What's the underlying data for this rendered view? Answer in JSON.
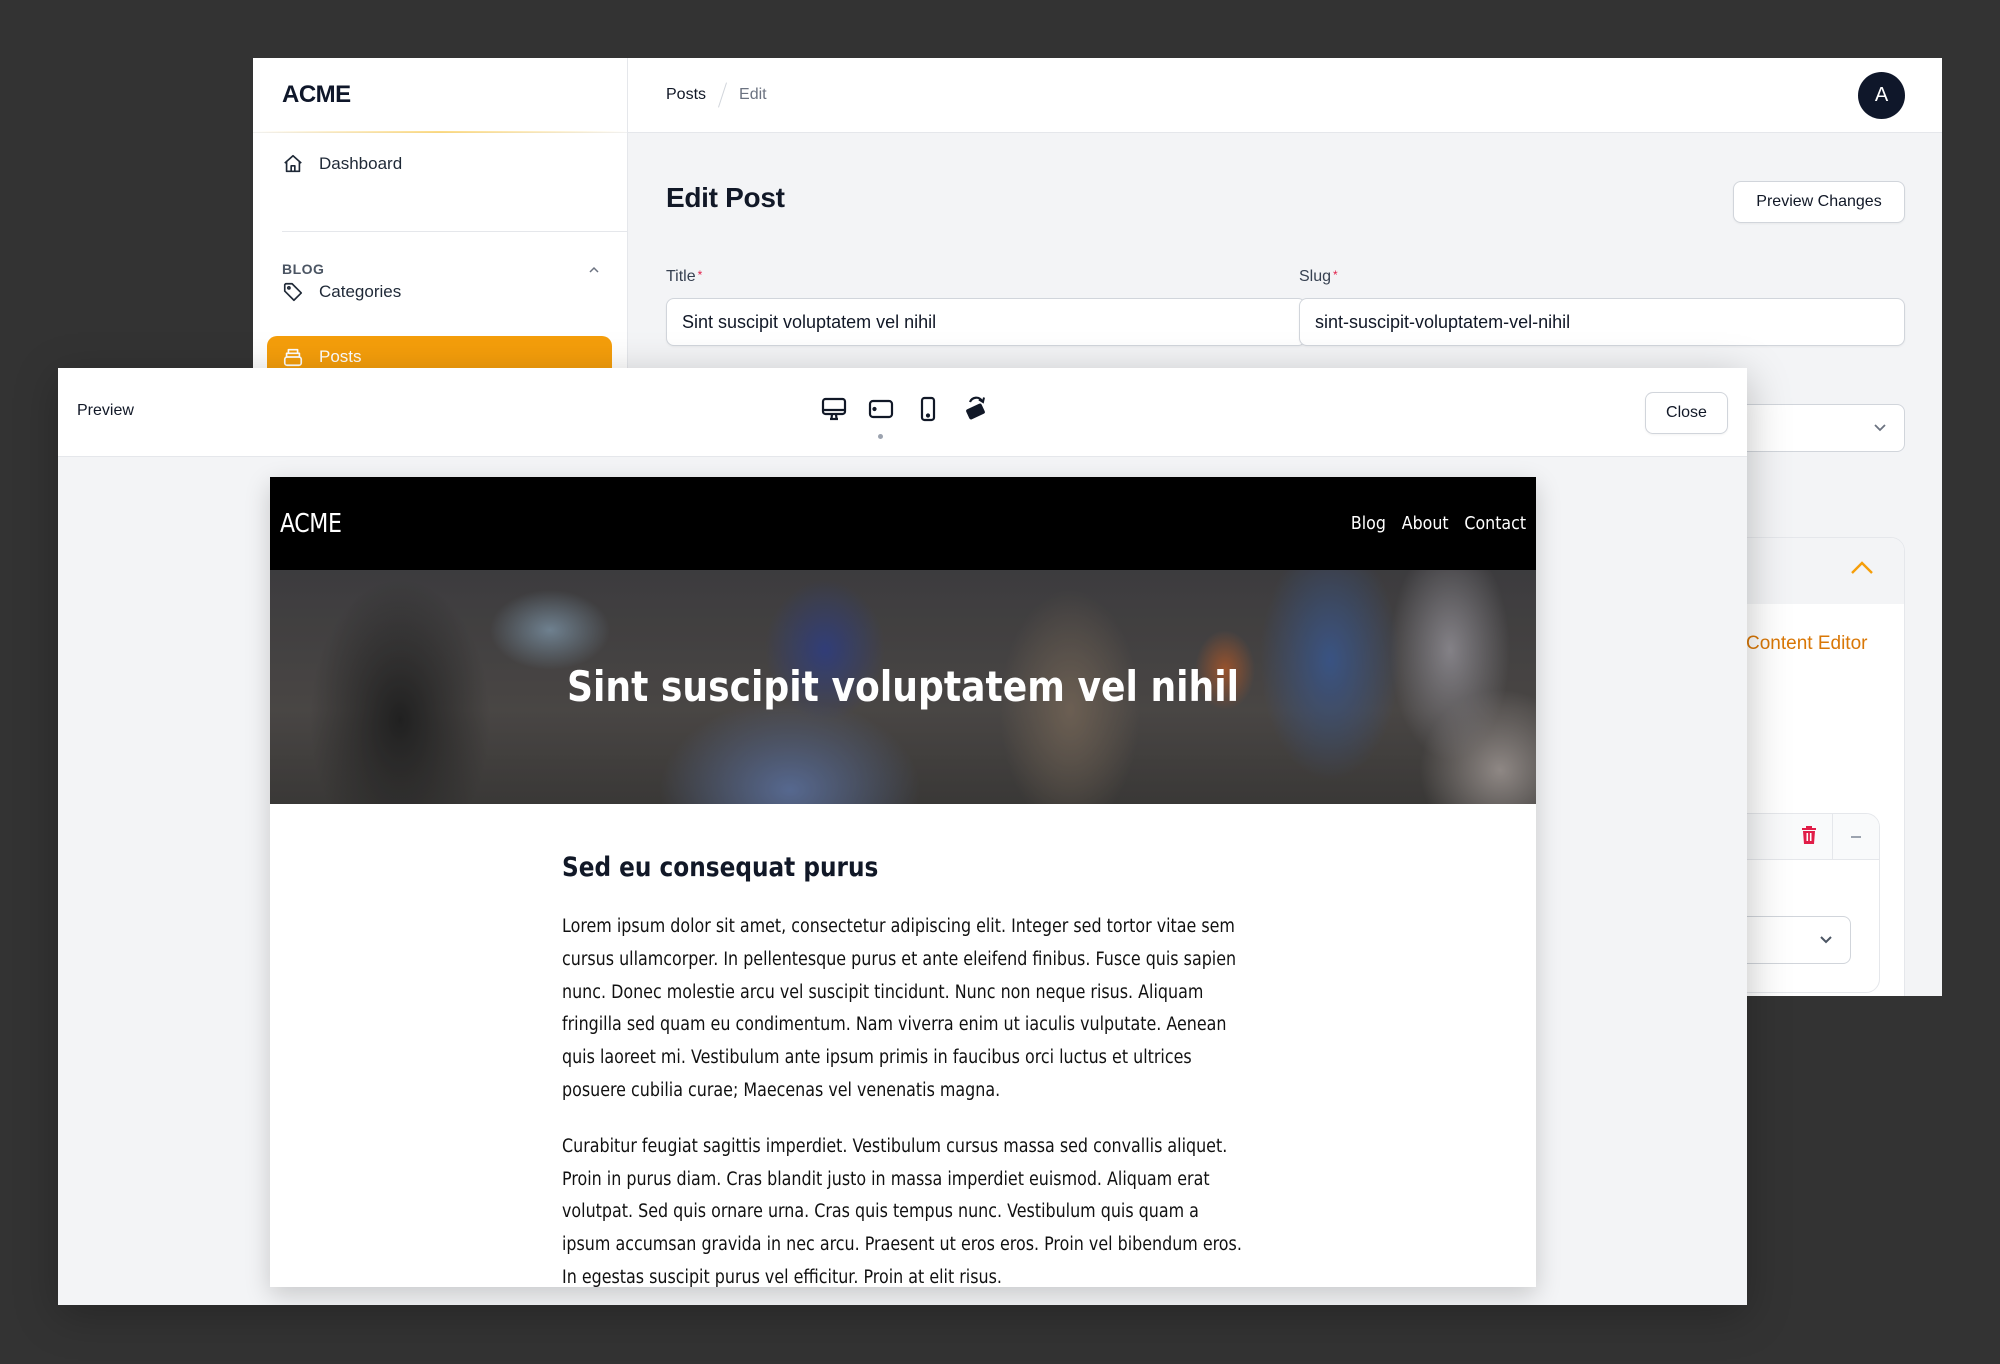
{
  "admin": {
    "brand": "ACME",
    "sidebar": {
      "items": [
        {
          "label": "Dashboard",
          "icon": "home-icon"
        },
        {
          "label": "Categories",
          "icon": "tag-icon"
        },
        {
          "label": "Posts",
          "icon": "document-stack-icon",
          "active": true
        }
      ],
      "group_label": "BLOG"
    },
    "breadcrumb": [
      "Posts",
      "Edit"
    ],
    "avatar_initial": "A",
    "page_title": "Edit Post",
    "preview_changes_label": "Preview Changes",
    "fields": {
      "title": {
        "label": "Title",
        "required_mark": "*",
        "value": "Sint suscipit voluptatem vel nihil"
      },
      "slug": {
        "label": "Slug",
        "required_mark": "*",
        "value": "sint-suscipit-voluptatem-vel-nihil"
      }
    },
    "content_editor_label": "Content Editor",
    "accent_color": "#f59e0b"
  },
  "preview": {
    "title": "Preview",
    "close_label": "Close",
    "devices": [
      "desktop-icon",
      "tablet-icon",
      "mobile-icon",
      "rotate-device-icon"
    ],
    "site": {
      "brand": "ACME",
      "nav": [
        "Blog",
        "About",
        "Contact"
      ],
      "hero_title": "Sint suscipit voluptatem vel nihil",
      "heading": "Sed eu consequat purus",
      "paragraphs": [
        "Lorem ipsum dolor sit amet, consectetur adipiscing elit. Integer sed tortor vitae sem cursus ullamcorper. In pellentesque purus et ante eleifend finibus. Fusce quis sapien nunc. Donec molestie arcu vel suscipit tincidunt. Nunc non neque risus. Aliquam fringilla sed quam eu condimentum. Nam viverra enim ut iaculis vulputate. Aenean quis laoreet mi. Vestibulum ante ipsum primis in faucibus orci luctus et ultrices posuere cubilia curae; Maecenas vel venenatis magna.",
        "Curabitur feugiat sagittis imperdiet. Vestibulum cursus massa sed convallis aliquet. Proin in purus diam. Cras blandit justo in massa imperdiet euismod. Aliquam erat volutpat. Sed quis ornare urna. Cras quis tempus nunc. Vestibulum quis quam a ipsum accumsan gravida in nec arcu. Praesent ut eros eros. Proin vel bibendum eros. In egestas suscipit purus vel efficitur. Proin at elit risus."
      ]
    }
  }
}
